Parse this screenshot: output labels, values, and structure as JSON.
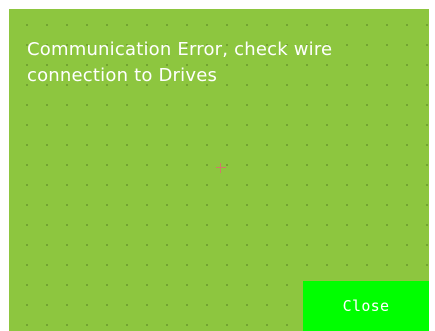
{
  "screen": {
    "background_color": "#8dc63f",
    "grid_dot_color": "#6d9d2e",
    "message": "Communication Error, check wire\nconnection to Drives",
    "close_button": {
      "label": "Close",
      "background_color": "#00ff00"
    },
    "crosshair_icon": "crosshair-icon"
  }
}
